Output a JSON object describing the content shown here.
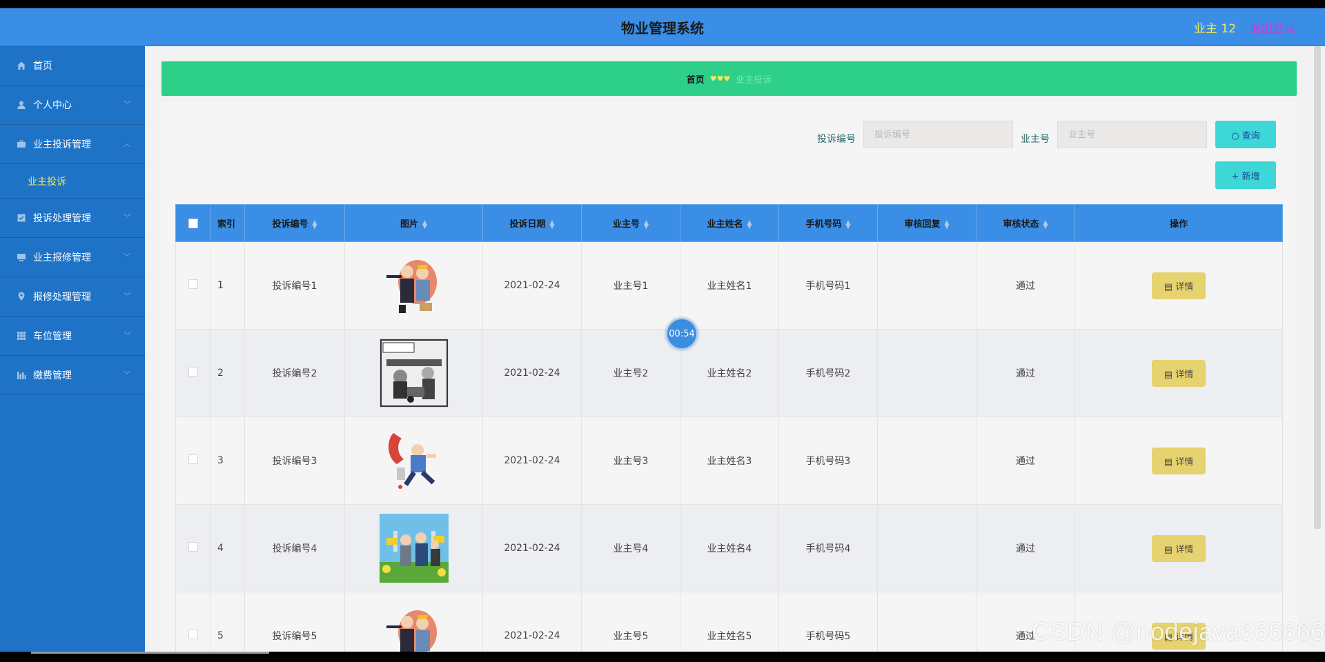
{
  "header": {
    "title": "物业管理系统",
    "user": "业主 12",
    "logout": "退出登录"
  },
  "sidebar": {
    "items": [
      {
        "label": "首页",
        "icon": "home-icon"
      },
      {
        "label": "个人中心",
        "icon": "user-icon"
      },
      {
        "label": "业主投诉管理",
        "icon": "briefcase-icon",
        "expanded": true,
        "sub": [
          "业主投诉"
        ]
      },
      {
        "label": "投诉处理管理",
        "icon": "checklist-icon"
      },
      {
        "label": "业主报修管理",
        "icon": "monitor-icon"
      },
      {
        "label": "报修处理管理",
        "icon": "location-icon"
      },
      {
        "label": "车位管理",
        "icon": "grid-icon"
      },
      {
        "label": "缴费管理",
        "icon": "bar-chart-icon"
      }
    ]
  },
  "breadcrumb": {
    "home": "首页",
    "separator": "♥♥♥",
    "current": "业主投诉"
  },
  "search": {
    "complaint_no_label": "投诉编号",
    "complaint_no_placeholder": "投诉编号",
    "owner_no_label": "业主号",
    "owner_no_placeholder": "业主号",
    "query_button": "查询",
    "add_button": "新增"
  },
  "table": {
    "columns": [
      "索引",
      "投诉编号",
      "图片",
      "投诉日期",
      "业主号",
      "业主姓名",
      "手机号码",
      "审核回复",
      "审核状态",
      "操作"
    ],
    "rows": [
      {
        "index": "1",
        "complaint_no": "投诉编号1",
        "date": "2021-02-24",
        "owner_no": "业主号1",
        "owner_name": "业主姓名1",
        "phone": "手机号码1",
        "reply": "",
        "status": "通过",
        "action": "详情"
      },
      {
        "index": "2",
        "complaint_no": "投诉编号2",
        "date": "2021-02-24",
        "owner_no": "业主号2",
        "owner_name": "业主姓名2",
        "phone": "手机号码2",
        "reply": "",
        "status": "通过",
        "action": "详情"
      },
      {
        "index": "3",
        "complaint_no": "投诉编号3",
        "date": "2021-02-24",
        "owner_no": "业主号3",
        "owner_name": "业主姓名3",
        "phone": "手机号码3",
        "reply": "",
        "status": "通过",
        "action": "详情"
      },
      {
        "index": "4",
        "complaint_no": "投诉编号4",
        "date": "2021-02-24",
        "owner_no": "业主号4",
        "owner_name": "业主姓名4",
        "phone": "手机号码4",
        "reply": "",
        "status": "通过",
        "action": "详情"
      },
      {
        "index": "5",
        "complaint_no": "投诉编号5",
        "date": "2021-02-24",
        "owner_no": "业主号5",
        "owner_name": "业主姓名5",
        "phone": "手机号码5",
        "reply": "",
        "status": "通过",
        "action": "详情"
      }
    ]
  },
  "overlay": {
    "timer": "00:54",
    "watermark": "CSDN @nodejava666666"
  },
  "colors": {
    "header": "#3a8ee6",
    "sidebar": "#1e73c7",
    "breadcrumb": "#2ecf89",
    "accent_button": "#3dd7d7",
    "detail_button": "#e6d26e",
    "highlight_text": "#f5e65a",
    "logout_text": "#c23fd6"
  }
}
